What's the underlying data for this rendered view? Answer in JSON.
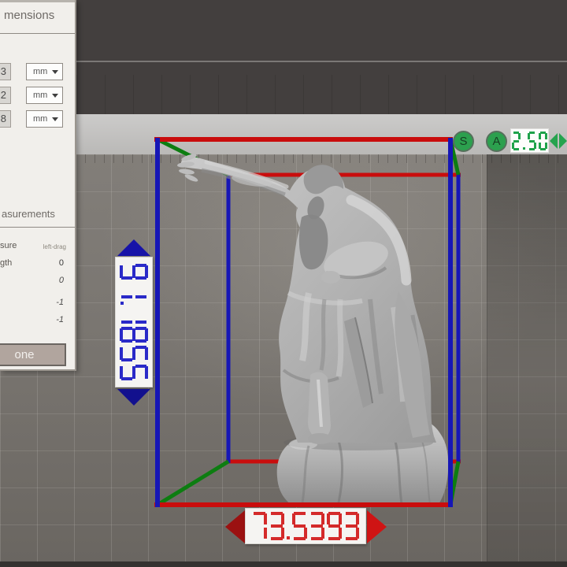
{
  "panel": {
    "title_fragment": "mensions",
    "dimension_rows": [
      {
        "value_fragment": "3",
        "unit": "mm"
      },
      {
        "value_fragment": "2",
        "unit": "mm"
      },
      {
        "value_fragment": "8",
        "unit": "mm"
      }
    ],
    "measurements": {
      "title_fragment": "asurements",
      "rows": [
        {
          "label_fragment": "sure",
          "value": "left-drag"
        },
        {
          "label_fragment": "gth",
          "value": "0"
        },
        {
          "label_fragment": "",
          "value": "0"
        },
        {
          "label_fragment": "",
          "value": "-1"
        },
        {
          "label_fragment": "",
          "value": "-1"
        }
      ]
    },
    "button_fragment": "one"
  },
  "viewport": {
    "height_label": "91.1855",
    "width_label": "73.5393",
    "scale": {
      "value": "2.50",
      "button_s": "S",
      "button_a": "A"
    },
    "colors": {
      "height_accent": "#2a2ac8",
      "width_accent": "#d42a2a",
      "scale_accent": "#1fa24b",
      "box_red": "#c90d0d",
      "box_blue": "#1616b6",
      "box_green": "#0d7d11"
    }
  }
}
